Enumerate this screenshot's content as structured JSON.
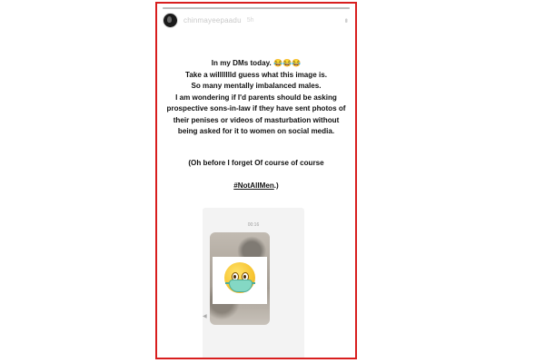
{
  "story": {
    "username": "chinmayeepaadu",
    "time": "5h",
    "progress_fraction": 1.0,
    "more_icon": "more-vertical-icon",
    "caption": {
      "lines": [
        "In my DMs today. 😂😂😂",
        "Take a willllllld guess what this image is.",
        "So many mentally imbalanced males.",
        "I am wondering if I'd parents should be asking prospective sons-in-law if they have sent photos of their penises or videos of masturbation without being asked for it to women on social media."
      ],
      "note_prefix": "(Oh before I forget Of course of course",
      "hashtag": "#NotAllMen",
      "note_suffix": ".)"
    },
    "screenshot": {
      "timestamp": "00:16",
      "emoji": "face-with-medical-mask"
    }
  },
  "colors": {
    "frame_border": "#d81e1e",
    "mask": "#84d8c4"
  }
}
